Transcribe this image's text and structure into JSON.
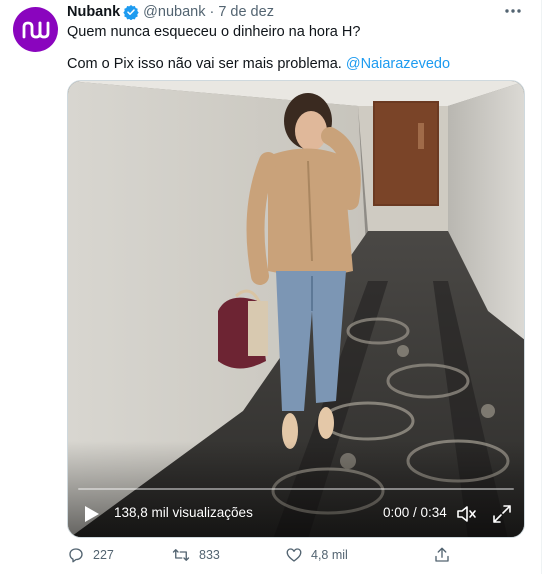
{
  "tweet": {
    "author_name": "Nubank",
    "handle": "@nubank",
    "separator": "·",
    "date": "7 de dez",
    "text_line1": "Quem nunca esqueceu o dinheiro na hora H?",
    "text_line2_prefix": "Com o Pix isso não vai ser mais problema.",
    "mention": "@Naiarazevedo"
  },
  "video": {
    "views": "138,8 mil visualizações",
    "time": "0:00 / 0:34",
    "progress": 0
  },
  "actions": {
    "replies": "227",
    "retweets": "833",
    "likes": "4,8 mil"
  },
  "colors": {
    "brand_purple": "#8a05be",
    "link_blue": "#1d9bf0",
    "secondary_text": "#536471"
  },
  "icons": [
    "nubank-logo",
    "verified-badge-icon",
    "more-icon",
    "play-icon",
    "volume-icon",
    "fullscreen-icon",
    "reply-icon",
    "retweet-icon",
    "like-icon",
    "share-icon"
  ]
}
